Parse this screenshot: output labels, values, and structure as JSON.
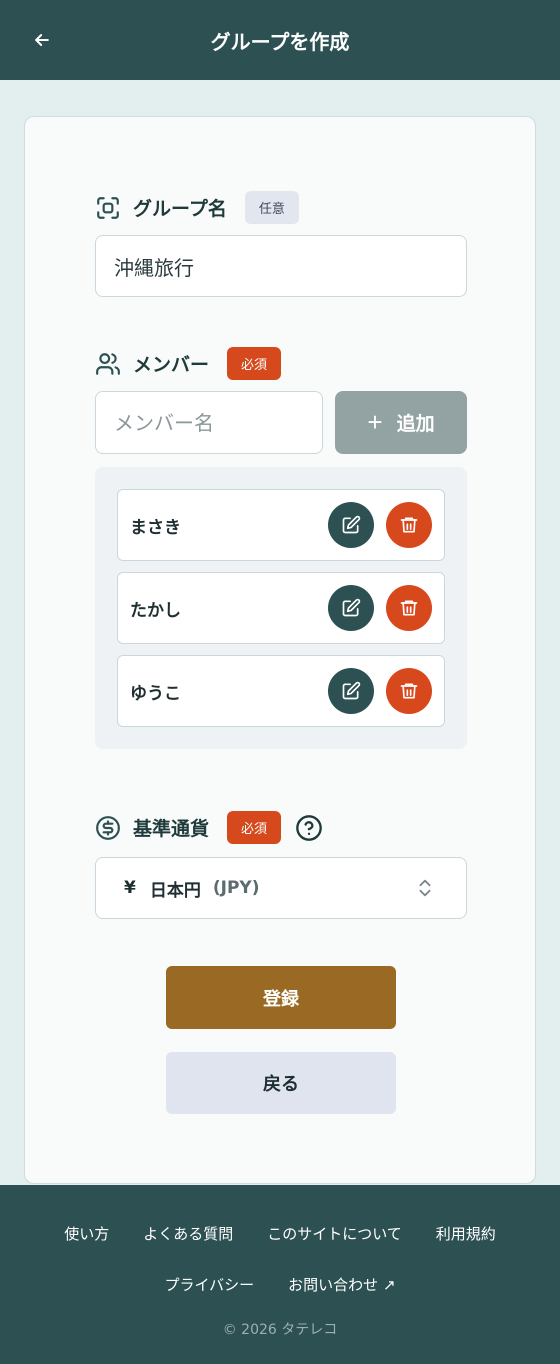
{
  "header": {
    "title": "グループを作成",
    "back_icon": "arrow-left-icon"
  },
  "group_name": {
    "label": "グループ名",
    "badge": "任意",
    "value": "沖縄旅行",
    "icon": "scan-face-icon"
  },
  "members": {
    "label": "メンバー",
    "badge": "必須",
    "input_placeholder": "メンバー名",
    "add_button_label": "追加",
    "icon": "users-icon",
    "list": [
      {
        "name": "まさき"
      },
      {
        "name": "たかし"
      },
      {
        "name": "ゆうこ"
      }
    ]
  },
  "currency": {
    "label": "基準通貨",
    "badge": "必須",
    "symbol": "¥",
    "name": "日本円",
    "code": "(JPY)",
    "icon": "dollar-circle-icon"
  },
  "actions": {
    "register_label": "登録",
    "back_label": "戻る"
  },
  "footer": {
    "links_row1": [
      "使い方",
      "よくある質問",
      "このサイトについて",
      "利用規約"
    ],
    "links_row2": [
      "プライバシー",
      "お問い合わせ ↗"
    ],
    "copyright": "© 2026 タテレコ"
  },
  "colors": {
    "header_bg": "#2d5052",
    "accent_brown": "#9a6a25",
    "danger": "#d8481d",
    "required_badge": "#d5491c"
  }
}
